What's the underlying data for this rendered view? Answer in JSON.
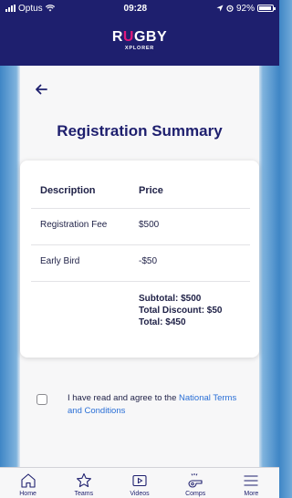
{
  "status_bar": {
    "carrier": "Optus",
    "time": "09:28",
    "battery": "92%",
    "battery_level": 0.92
  },
  "header": {
    "logo_main_prefix": "R",
    "logo_main_accent": "U",
    "logo_main_suffix": "GBY",
    "logo_sub": "XPLORER",
    "colors": {
      "bar": "#1e1f6e",
      "accent": "#e0197d"
    }
  },
  "page": {
    "title": "Registration Summary"
  },
  "summary_table": {
    "headers": [
      "Description",
      "Price"
    ],
    "rows": [
      {
        "description": "Registration Fee",
        "price": "$500"
      },
      {
        "description": "Early Bird",
        "price": "-$50"
      }
    ],
    "subtotal": "Subtotal: $500",
    "total_discount": "Total Discount: $50",
    "total": "Total: $450"
  },
  "agreement": {
    "text": "I have read and agree to the ",
    "link_text": "National Terms and Conditions",
    "checked": false
  },
  "tabbar": {
    "items": [
      {
        "label": "Home",
        "icon": "home-icon"
      },
      {
        "label": "Teams",
        "icon": "star-icon"
      },
      {
        "label": "Videos",
        "icon": "video-play-icon"
      },
      {
        "label": "Comps",
        "icon": "whistle-icon"
      },
      {
        "label": "More",
        "icon": "menu-icon"
      }
    ]
  }
}
